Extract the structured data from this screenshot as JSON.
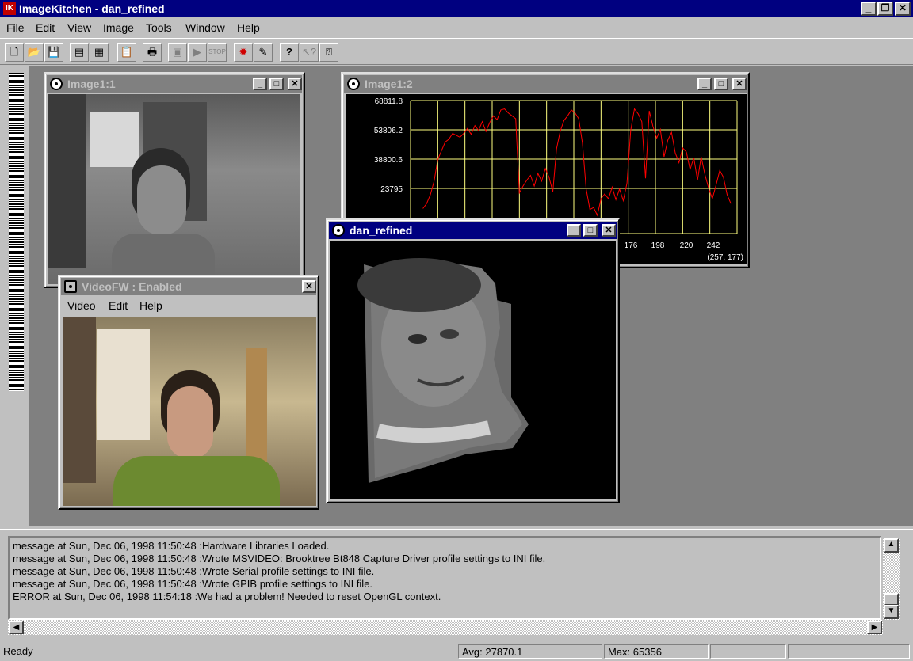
{
  "app": {
    "title": "ImageKitchen - dan_refined",
    "icon_label": "IK"
  },
  "menubar": [
    "File",
    "Edit",
    "View",
    "Image",
    "Tools",
    "Window",
    "Help"
  ],
  "toolbar": [
    "new-file-icon",
    "open-folder-icon",
    "save-disk-icon",
    "properties-icon",
    "settings-icon",
    "paste-icon",
    "print-icon",
    "camera-icon",
    "play-icon",
    "stop-icon",
    "light-icon",
    "acquire-icon",
    "help-icon",
    "context-help-icon",
    "whats-this-icon"
  ],
  "windows": {
    "image1_1": {
      "title": "Image1:1"
    },
    "image1_2": {
      "title": "Image1:2",
      "coord_readout": "(257, 177)"
    },
    "videofw": {
      "title": "VideoFW : Enabled",
      "menu": [
        "Video",
        "Edit",
        "Help"
      ]
    },
    "dan_refined": {
      "title": "dan_refined"
    }
  },
  "chart_data": {
    "type": "line",
    "title": "",
    "xlabel": "",
    "ylabel": "",
    "y_ticks": [
      "68811.8",
      "53806.2",
      "38800.6",
      "23795"
    ],
    "x_ticks_visible": [
      "176",
      "198",
      "220",
      "242"
    ],
    "line_color": "#ff0000",
    "background": "#000000",
    "grid": true,
    "grid_color": "#ffff80",
    "x": [
      10,
      13,
      16,
      19,
      22,
      25,
      28,
      31,
      34,
      37,
      40,
      43,
      46,
      49,
      52,
      55,
      58,
      61,
      64,
      67,
      70,
      73,
      76,
      79,
      82,
      85,
      88,
      91,
      94,
      97,
      100,
      103,
      106,
      109,
      112,
      115,
      118,
      121,
      124,
      127,
      130,
      133,
      136,
      139,
      142,
      145,
      148,
      151,
      154,
      157,
      160,
      163,
      166,
      169,
      172,
      175,
      178,
      181,
      184,
      187,
      190,
      193,
      196,
      199,
      202,
      205,
      208,
      211,
      214,
      217,
      220,
      223,
      226,
      229,
      232,
      235,
      238,
      241,
      244,
      247,
      250,
      253,
      256,
      259
    ],
    "y": [
      13500,
      16000,
      20500,
      27500,
      38500,
      43000,
      47500,
      49000,
      52000,
      51000,
      50000,
      52000,
      54500,
      51500,
      56000,
      53500,
      58000,
      53000,
      57500,
      61000,
      59000,
      64000,
      64500,
      62500,
      61000,
      59500,
      21500,
      25000,
      28000,
      30500,
      25000,
      31500,
      27500,
      34000,
      29500,
      22000,
      44000,
      53000,
      58500,
      61000,
      64000,
      62500,
      59500,
      47000,
      23500,
      13000,
      14000,
      10000,
      18500,
      21000,
      18500,
      24500,
      18000,
      23500,
      17500,
      26500,
      53500,
      64500,
      62000,
      58000,
      29000,
      63500,
      55500,
      49500,
      54000,
      40000,
      48500,
      52500,
      42000,
      37000,
      44500,
      42500,
      33500,
      39500,
      28000,
      40000,
      31000,
      24000,
      18500,
      25500,
      33000,
      29500,
      20500,
      16000
    ]
  },
  "log": {
    "lines": [
      "message at Sun, Dec 06, 1998  11:50:48 :Hardware Libraries Loaded.",
      "message at Sun, Dec 06, 1998  11:50:48 :Wrote MSVIDEO: Brooktree Bt848 Capture Driver profile settings to INI file.",
      "message at Sun, Dec 06, 1998  11:50:48 :Wrote Serial profile settings to INI file.",
      "message at Sun, Dec 06, 1998  11:50:48 :Wrote GPIB profile settings to INI file.",
      "  ERROR at Sun, Dec 06, 1998  11:54:18 :We had a problem! Needed to reset OpenGL context."
    ]
  },
  "statusbar": {
    "ready": "Ready",
    "avg": "Avg: 27870.1",
    "max": "Max: 65356"
  }
}
